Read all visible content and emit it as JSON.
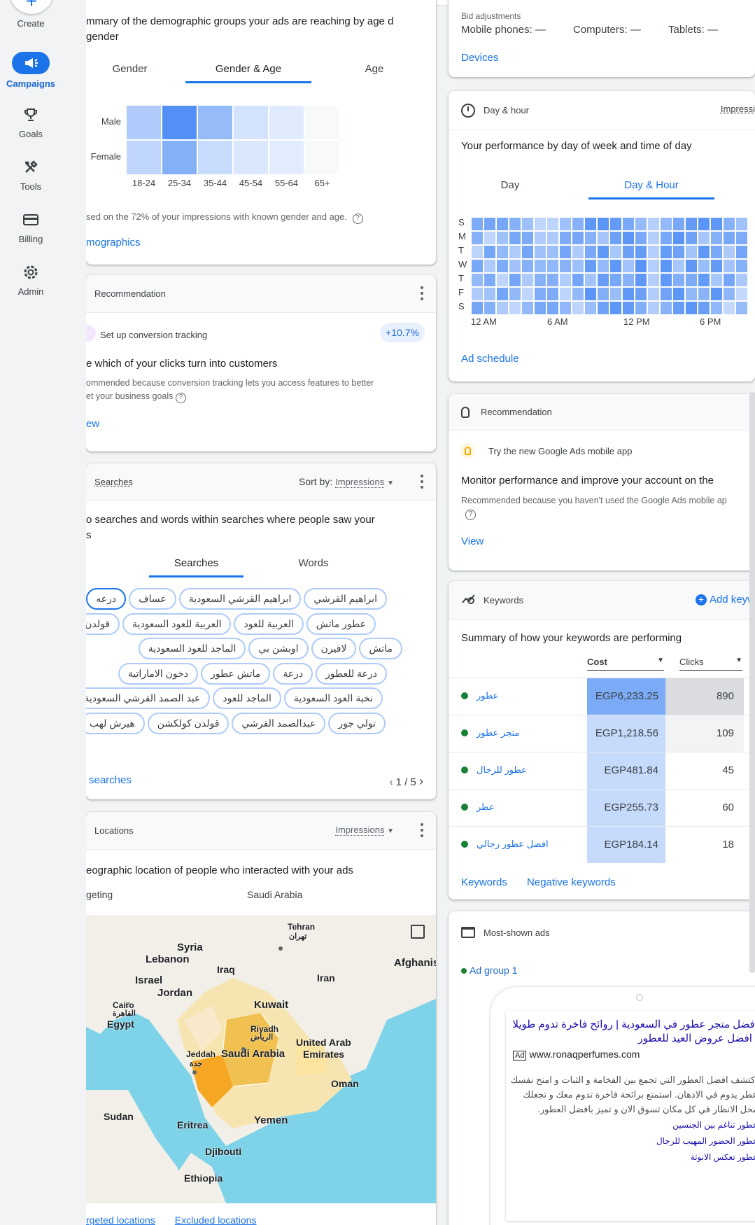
{
  "nav": {
    "create": "Create",
    "items": [
      {
        "label": "Campaigns",
        "active": true
      },
      {
        "label": "Goals"
      },
      {
        "label": "Tools"
      },
      {
        "label": "Billing"
      },
      {
        "label": "Admin"
      }
    ]
  },
  "demographics": {
    "title": "mmary of the demographic groups your ads are reaching by age d gender",
    "tabs": [
      "Gender",
      "Gender & Age",
      "Age"
    ],
    "rows": [
      "Male",
      "Female"
    ],
    "cols": [
      "18-24",
      "25-34",
      "35-44",
      "45-54",
      "55-64",
      "65+"
    ],
    "levels": [
      [
        0.35,
        0.9,
        0.5,
        0.12,
        0.05,
        0.03
      ],
      [
        0.25,
        0.6,
        0.2,
        0.08,
        0.04,
        0.02
      ]
    ],
    "note": "sed on the 72% of your impressions with known gender and age.",
    "link": "mographics"
  },
  "rec_conversion": {
    "header": "Recommendation",
    "subtitle": "Set up conversion tracking",
    "badge": "+10.7%",
    "title": "e which of your clicks turn into customers",
    "desc1": "ommended because conversion tracking lets you access features to better",
    "desc2": "et your business goals",
    "link": "ew"
  },
  "searches": {
    "header": "Searches",
    "sort_prefix": "Sort by:",
    "sort_value": "Impressions",
    "title": "o searches and words within searches where people saw your",
    "title2": "s",
    "tabs": [
      "Searches",
      "Words"
    ],
    "chips": [
      [
        "ابراهيم القرشي",
        "ابراهيم القرشي السعودية",
        "عساف",
        "درعه"
      ],
      [
        "عطور ماتش",
        "العربية للعود",
        "العربية للعود السعودية",
        "قولدن سنت"
      ],
      [
        "ماتش",
        "لافيرن",
        "اوبشن بي",
        "الماجد للعود السعودية"
      ],
      [
        "درعة للعطور",
        "درعة",
        "ماتش عطور",
        "دخون الاماراتية"
      ],
      [
        "نخبة العود السعودية",
        "الماجد للعود",
        "عبد الصمد القرشي السعودية"
      ],
      [
        "تولي جور",
        "عبدالصمد القرشي",
        "قولدن كولكشن",
        "هيرش لهب"
      ]
    ],
    "link": "searches",
    "pager": "1 / 5"
  },
  "locations": {
    "header": "Locations",
    "sort_value": "Impressions",
    "title": "eographic location of people who interacted with your ads",
    "col1": "geting",
    "col2": "Saudi Arabia",
    "map_labels": [
      "Tehran",
      "تهران",
      "Syria",
      "Lebanon",
      "Iraq",
      "Afghanis",
      "Israel",
      "Iran",
      "Jordan",
      "Cairo",
      "القاهرة",
      "Egypt",
      "Kuwait",
      "Riyadh",
      "الرياض",
      "United Arab",
      "Emirates",
      "Jeddah",
      "جدة",
      "Saudi Arabia",
      "Oman",
      "Sudan",
      "Eritrea",
      "Yemen",
      "Djibouti",
      "Ethiopia"
    ],
    "tabs": [
      "rgeted locations",
      "Excluded locations"
    ]
  },
  "devices": {
    "bid_label": "Bid adjustments",
    "mobile": "Mobile phones: —",
    "computers": "Computers: —",
    "tablets": "Tablets: —",
    "link": "Devices"
  },
  "dayhour": {
    "header": "Day & hour",
    "header_right": "Impressi",
    "title": "Your performance by day of week and time of day",
    "tabs": [
      "Day",
      "Day & Hour"
    ],
    "days": [
      "S",
      "M",
      "T",
      "W",
      "T",
      "F",
      "S"
    ],
    "hours": [
      "12 AM",
      "6 AM",
      "12 PM",
      "6 PM"
    ],
    "link": "Ad schedule"
  },
  "rec_app": {
    "header": "Recommendation",
    "subtitle": "Try the new Google Ads mobile app",
    "title": "Monitor performance and improve your account on the",
    "desc": "Recommended because you haven't used the Google Ads mobile ap",
    "link": "View"
  },
  "keywords": {
    "header": "Keywords",
    "add": "Add keyw",
    "title": "Summary of how your keywords are performing",
    "cols": [
      "Cost",
      "Clicks"
    ],
    "rows": [
      {
        "kw": "عطور",
        "cost": "EGP6,233.25",
        "clicks": "890"
      },
      {
        "kw": "متجر عطور",
        "cost": "EGP1,218.56",
        "clicks": "109"
      },
      {
        "kw": "عطور للرجال",
        "cost": "EGP481.84",
        "clicks": "45"
      },
      {
        "kw": "عطر",
        "cost": "EGP255.73",
        "clicks": "60"
      },
      {
        "kw": "افضل عطور رجالي",
        "cost": "EGP184.14",
        "clicks": "18"
      }
    ],
    "links": [
      "Keywords",
      "Negative keywords"
    ]
  },
  "ads": {
    "header": "Most-shown ads",
    "group": "Ad group 1",
    "headline1": "افضل متجر عطور في السعودية | روائح فاخرة تدوم طويلا",
    "headline2": "| افضل عروض العيد للعطور",
    "ad_badge": "Ad",
    "url": "www.ronaqperfumes.com",
    "desc1": "اكتشف افضل العطور التي تجمع بين الفخامة و الثبات و امنح نفسك",
    "desc2": "عطر يدوم في الاذهان. استمتع برائحة فاخرة تدوم معك و تجعلك",
    "desc3": "محل الانظار في كل مكان تسوق الان و تميز بافضل العطور.",
    "sitelinks": [
      "عطور تناغم بين الجنسين",
      "عطور الحضور المهيب للرجال",
      "عطور تعكس الانوثة"
    ]
  },
  "colors": {
    "accent": "#1a73e8",
    "heat_max": "#4285f4",
    "heat_min": "#e8f0fe"
  }
}
